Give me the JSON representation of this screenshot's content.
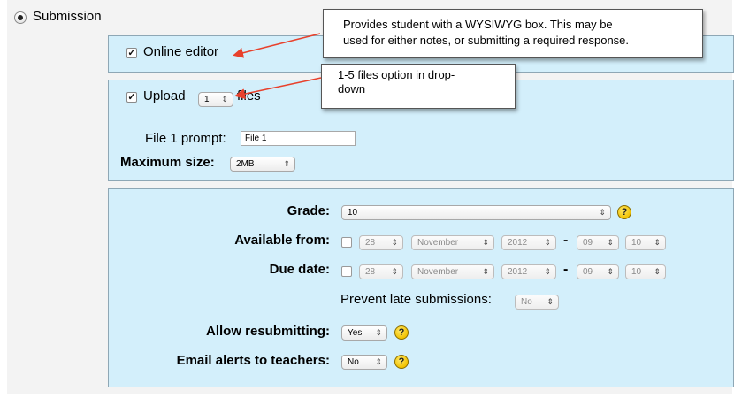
{
  "submission": {
    "label": "Submission"
  },
  "online_editor": {
    "label": "Online editor",
    "checked": true
  },
  "upload": {
    "label_before": "Upload",
    "files_value": "1",
    "label_after": "files",
    "checked": true
  },
  "file_prompt": {
    "label": "File 1 prompt:",
    "value": "File 1"
  },
  "max_size": {
    "label": "Maximum size:",
    "value": "2MB"
  },
  "grade": {
    "label": "Grade:",
    "value": "10"
  },
  "available_from": {
    "label": "Available from:",
    "day": "28",
    "month": "November",
    "year": "2012",
    "hour": "09",
    "minute": "10",
    "separator": "-"
  },
  "due_date": {
    "label": "Due date:",
    "day": "28",
    "month": "November",
    "year": "2012",
    "hour": "09",
    "minute": "10",
    "separator": "-"
  },
  "prevent_late": {
    "label": "Prevent late submissions:",
    "value": "No"
  },
  "allow_resubmit": {
    "label": "Allow resubmitting:",
    "value": "Yes"
  },
  "email_alerts": {
    "label": "Email alerts to teachers:",
    "value": "No"
  },
  "help": {
    "glyph": "?"
  },
  "checkmark": "✓",
  "select_arrow": "⇕",
  "callouts": [
    {
      "line1": "Provides student with a WYSIWYG box. This may be",
      "line2": "used for either notes, or submitting a required response."
    },
    {
      "line1": "1-5 files option in drop-",
      "line2": "down"
    }
  ],
  "colors": {
    "panel": "#d3effb",
    "panel_border": "#8ea7b5",
    "arrow": "#e8412c",
    "help": "#f2c200"
  }
}
